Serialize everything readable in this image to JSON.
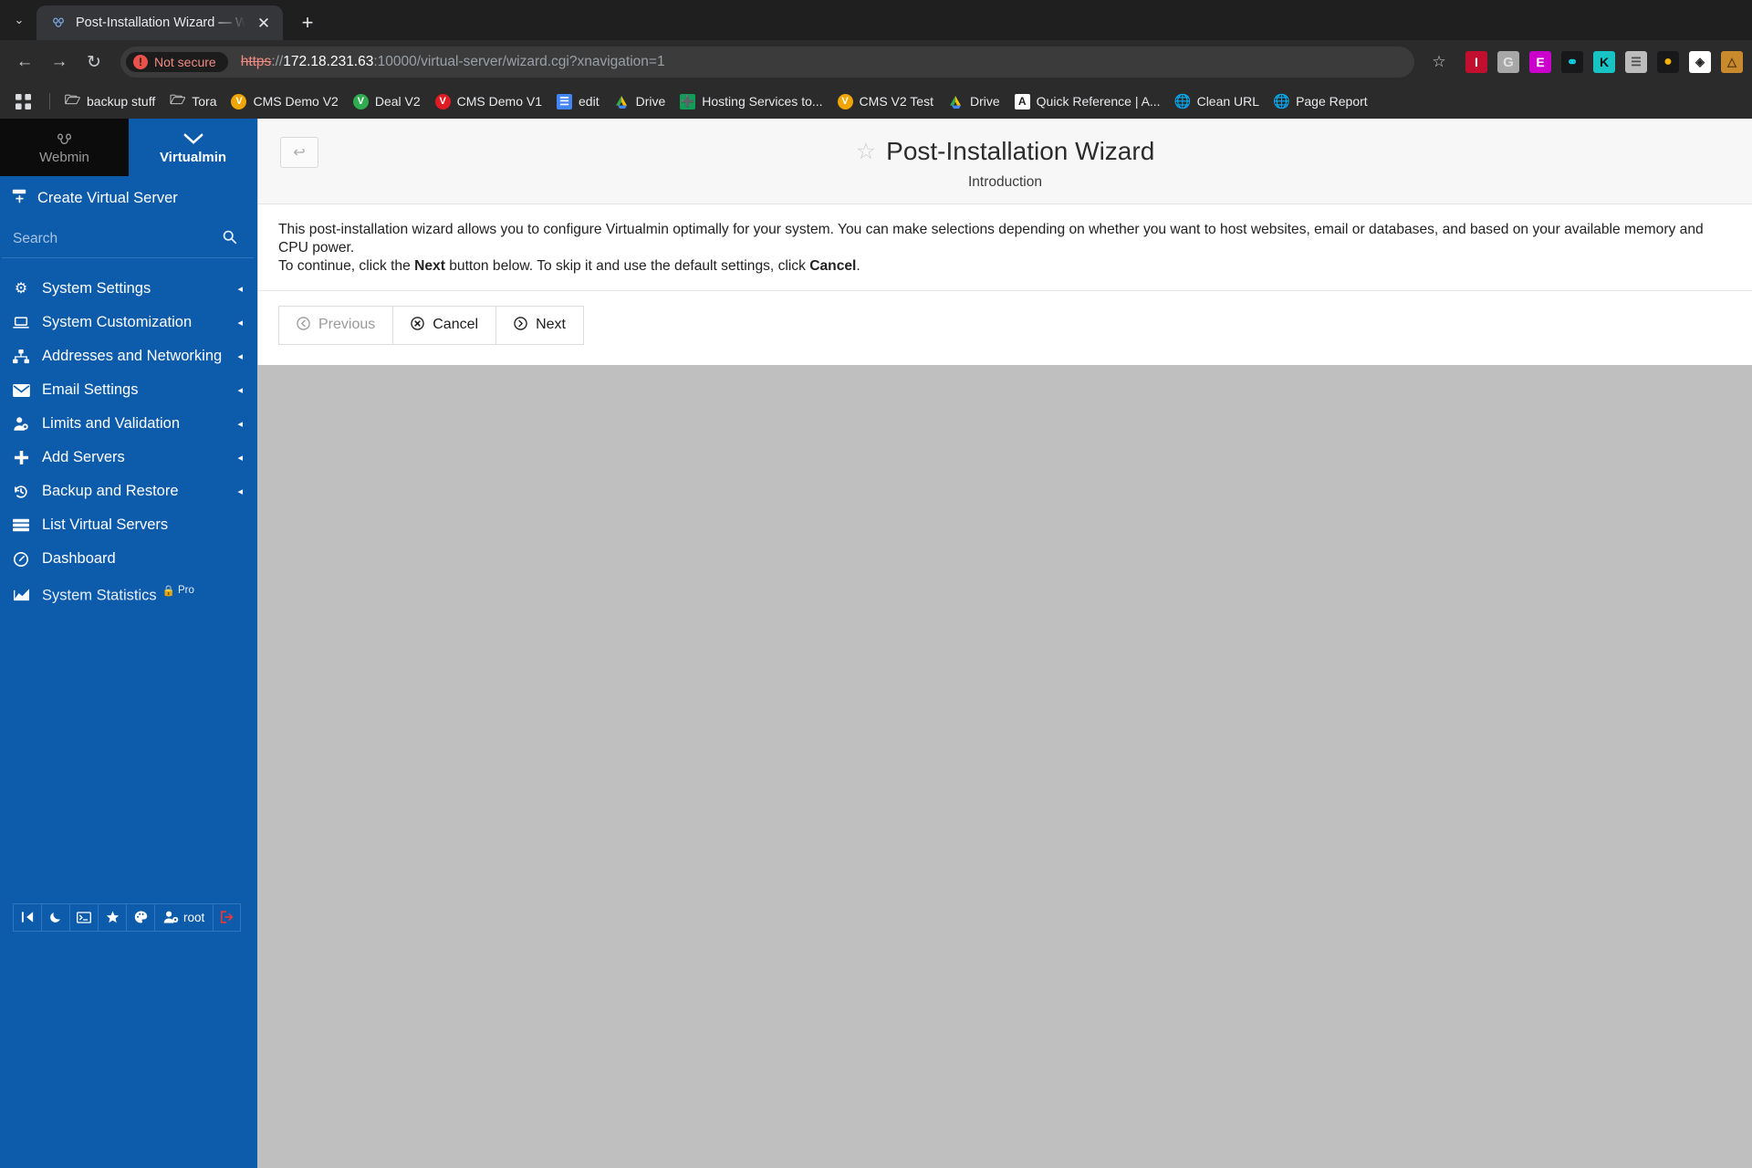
{
  "browser": {
    "tab": {
      "title": "Post-Installation Wizard — Webmin",
      "favicon": "webmin-logo-icon",
      "close_label": "✕",
      "new_tab_label": "+",
      "tabstrip_caret": "⌄"
    },
    "nav": {
      "back": "←",
      "forward": "→",
      "reload": "↻"
    },
    "omnibox": {
      "security_label": "Not secure",
      "security_icon_glyph": "!",
      "url_scheme": "https",
      "url_separator": "://",
      "url_host": "172.18.231.63",
      "url_rest": ":10000/virtual-server/wizard.cgi?xnavigation=1",
      "full_url": "https://172.18.231.63:10000/virtual-server/wizard.cgi?xnavigation=1",
      "star_glyph": "☆"
    },
    "extensions": [
      {
        "name": "red-i-extension-icon",
        "glyph": "I",
        "bg": "#c20f2f",
        "fg": "#ffffff"
      },
      {
        "name": "grey-g-extension-icon",
        "glyph": "G",
        "bg": "#a7a7a7",
        "fg": "#e8e8e8"
      },
      {
        "name": "purple-e-extension-icon",
        "glyph": "E",
        "bg": "#cc00cc",
        "fg": "#ffffff"
      },
      {
        "name": "link-checker-extension-icon",
        "glyph": "⚭",
        "bg": "#06b6d4",
        "fg": "#0b3b46"
      },
      {
        "name": "keywords-extension-icon",
        "glyph": "K",
        "bg": "#17c3c3",
        "fg": "#111111"
      },
      {
        "name": "database-extension-icon",
        "glyph": "☲",
        "bg": "#bcbcbc",
        "fg": "#555555"
      },
      {
        "name": "chrome-extension-icon",
        "glyph": "●",
        "bg": "#1a1a1a",
        "fg": "#f4b400"
      },
      {
        "name": "diamond-extension-icon",
        "glyph": "◈",
        "bg": "#ffffff",
        "fg": "#222222"
      },
      {
        "name": "camel-extension-icon",
        "glyph": "ὂa",
        "bg": "#c98a2e",
        "fg": "#6b4414"
      }
    ],
    "bookmarks": {
      "apps_icon": "apps-grid-icon",
      "items": [
        {
          "label": "backup stuff",
          "icon": "folder-icon",
          "icon_glyph": "□",
          "bg": "transparent",
          "fg": "#cfcfcf"
        },
        {
          "label": "Tora",
          "icon": "folder-icon",
          "icon_glyph": "□",
          "bg": "transparent",
          "fg": "#cfcfcf"
        },
        {
          "label": "CMS Demo V2",
          "icon": "v-badge-icon",
          "icon_glyph": "V",
          "bg": "#f0a500",
          "fg": "#ffffff"
        },
        {
          "label": "Deal V2",
          "icon": "v-badge-icon",
          "icon_glyph": "V",
          "bg": "#2eac4f",
          "fg": "#ffffff"
        },
        {
          "label": "CMS Demo V1",
          "icon": "v-badge-icon",
          "icon_glyph": "V",
          "bg": "#e01b24",
          "fg": "#ffffff"
        },
        {
          "label": "edit",
          "icon": "google-docs-icon",
          "icon_glyph": "≡",
          "bg": "#4285f4",
          "fg": "#ffffff"
        },
        {
          "label": "Drive",
          "icon": "google-drive-icon",
          "icon_glyph": "▲",
          "bg": "transparent",
          "fg": "#fbbc04"
        },
        {
          "label": "Hosting Services to...",
          "icon": "google-sheets-icon",
          "icon_glyph": "✚",
          "bg": "#0f9d58",
          "fg": "#ffffff"
        },
        {
          "label": "CMS V2 Test",
          "icon": "v-badge-icon",
          "icon_glyph": "V",
          "bg": "#f0a500",
          "fg": "#ffffff"
        },
        {
          "label": "Drive",
          "icon": "google-drive-icon",
          "icon_glyph": "▲",
          "bg": "transparent",
          "fg": "#fbbc04"
        },
        {
          "label": "Quick Reference | A...",
          "icon": "a-badge-icon",
          "icon_glyph": "A",
          "bg": "#ffffff",
          "fg": "#222222"
        },
        {
          "label": "Clean URL",
          "icon": "globe-icon",
          "icon_glyph": "⊕",
          "bg": "transparent",
          "fg": "#c8c8c8"
        },
        {
          "label": "Page Report",
          "icon": "globe-icon",
          "icon_glyph": "⊕",
          "bg": "transparent",
          "fg": "#c8c8c8"
        }
      ]
    }
  },
  "sidebar": {
    "tabs": [
      {
        "label": "Webmin",
        "icon": "webmin-logo-icon",
        "active": false
      },
      {
        "label": "Virtualmin",
        "icon": "chevron-down-icon",
        "active": true
      }
    ],
    "create_virtual_server": "Create Virtual Server",
    "search_placeholder": "Search",
    "search_value": "",
    "nav_items": [
      {
        "label": "System Settings",
        "icon": "gear-icon",
        "icon_glyph": "⚙",
        "caret": "◂"
      },
      {
        "label": "System Customization",
        "icon": "laptop-icon",
        "icon_glyph": "▭",
        "caret": "◂"
      },
      {
        "label": "Addresses and Networking",
        "icon": "sitemap-icon",
        "icon_glyph": "⛓",
        "caret": "◂"
      },
      {
        "label": "Email Settings",
        "icon": "envelope-icon",
        "icon_glyph": "✉",
        "caret": "◂"
      },
      {
        "label": "Limits and Validation",
        "icon": "user-shield-icon",
        "icon_glyph": "⛉",
        "caret": "◂"
      },
      {
        "label": "Add Servers",
        "icon": "plus-icon",
        "icon_glyph": "✚",
        "caret": "◂"
      },
      {
        "label": "Backup and Restore",
        "icon": "history-icon",
        "icon_glyph": "↺",
        "caret": "◂"
      },
      {
        "label": "List Virtual Servers",
        "icon": "server-list-icon",
        "icon_glyph": "☰",
        "caret": ""
      },
      {
        "label": "Dashboard",
        "icon": "gauge-icon",
        "icon_glyph": "◔",
        "caret": ""
      },
      {
        "label": "System Statistics",
        "icon": "chart-area-icon",
        "icon_glyph": "◢",
        "caret": "",
        "badge": "Pro",
        "badge_icon": "lock-icon",
        "badge_icon_glyph": "ὑ2"
      }
    ],
    "tools": [
      {
        "name": "collapse-sidebar-button",
        "glyph": "⧽|",
        "label": ""
      },
      {
        "name": "dark-mode-button",
        "glyph": "☾",
        "label": ""
      },
      {
        "name": "terminal-button",
        "glyph": "⌨",
        "label": ""
      },
      {
        "name": "favorites-button",
        "glyph": "★",
        "label": ""
      },
      {
        "name": "theme-palette-button",
        "glyph": "◕",
        "label": ""
      },
      {
        "name": "user-account-button",
        "glyph": "☺",
        "label": "root"
      },
      {
        "name": "logout-button",
        "glyph": "⇥",
        "label": ""
      }
    ]
  },
  "main": {
    "back_button_glyph": "↩",
    "title": "Post-Installation Wizard",
    "title_star_glyph": "☆",
    "subtitle": "Introduction",
    "paragraph_1": "This post-installation wizard allows you to configure Virtualmin optimally for your system. You can make selections depending on whether you want to host websites, email or databases, and based on your available memory and CPU power.",
    "paragraph_2_pre": "To continue, click the ",
    "paragraph_2_bold_1": "Next",
    "paragraph_2_mid": " button below. To skip it and use the default settings, click ",
    "paragraph_2_bold_2": "Cancel",
    "paragraph_2_post": ".",
    "buttons": [
      {
        "name": "previous-button",
        "label": "Previous",
        "icon": "arrow-left-circle-icon",
        "glyph": "⬅",
        "state": "disabled"
      },
      {
        "name": "cancel-button",
        "label": "Cancel",
        "icon": "x-circle-icon",
        "glyph": "✖",
        "state": "enabled"
      },
      {
        "name": "next-button",
        "label": "Next",
        "icon": "arrow-right-circle-icon",
        "glyph": "➡",
        "state": "enabled"
      }
    ]
  }
}
